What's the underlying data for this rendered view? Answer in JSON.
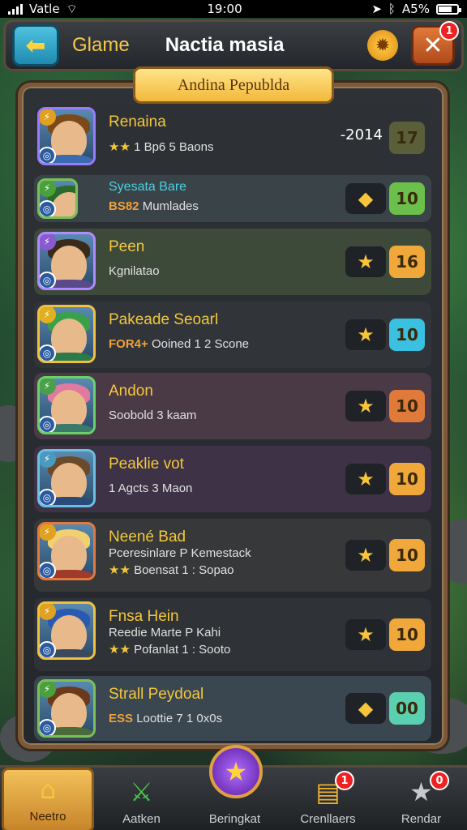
{
  "status_bar": {
    "carrier": "Vatle",
    "time": "19:00",
    "battery_text": "A5%"
  },
  "header": {
    "game_label": "Glame",
    "title": "Nactia masia",
    "close_badge": "1"
  },
  "panel": {
    "title": "Andina Pepublda"
  },
  "rows": [
    {
      "name": "Renaina",
      "sub": "1 Bp6 5 Baons",
      "stars": "★★",
      "extra": "-2014",
      "score": "17",
      "score_color": "#5a5f3a",
      "row_bg": "#2d3135",
      "avatar_border": "#9a7aff",
      "hair": "#7a4a1a",
      "body": "#3a6ab0",
      "tl_bg": "#e0a020",
      "star_icon": ""
    },
    {
      "name": "Syesata Bare",
      "sub": "Mumlades",
      "tag": "BS82",
      "score": "10",
      "score_color": "#6ac04a",
      "row_bg": "#3a4448",
      "avatar_border": "#7ac05a",
      "hair": "#2a6a2a",
      "body": "#7a3a1a",
      "tl_bg": "#4aa03a",
      "star_icon": "◆"
    },
    {
      "name": "Peen",
      "sub": "Kgnilatao",
      "score": "16",
      "score_color": "#f0a83a",
      "row_bg": "#3d4a3a",
      "avatar_border": "#b08aff",
      "hair": "#3a2a1a",
      "body": "#5a4a8a",
      "tl_bg": "#8a5ad0",
      "star_icon": "★"
    },
    {
      "name": "Pakeade Seoarl",
      "sub": "Ooined 1 2 Scone",
      "tag": "FOR4+",
      "score": "10",
      "score_color": "#3ac0e0",
      "row_bg": "#31353a",
      "avatar_border": "#f0c040",
      "hair": "#3aa04a",
      "body": "#2a7a4a",
      "tl_bg": "#e0b020",
      "star_icon": "★"
    },
    {
      "name": "Andon",
      "sub": "Soobold 3 kaam",
      "score": "10",
      "score_color": "#e07a3a",
      "row_bg": "#4a3a46",
      "avatar_border": "#6ad06a",
      "hair": "#e07aa0",
      "body": "#3a7a6a",
      "tl_bg": "#4aa04a",
      "star_icon": "★"
    },
    {
      "name": "Peaklie vot",
      "sub": "1 Agcts 3 Maon",
      "score": "10",
      "score_color": "#f0a83a",
      "row_bg": "#3d3246",
      "avatar_border": "#6ac0e0",
      "hair": "#6a4a2a",
      "body": "#2a4a7a",
      "tl_bg": "#4a9ac0",
      "star_icon": "★"
    },
    {
      "name": "Neené Bad",
      "sub": "Pceresinlare P Kemestack",
      "sub2": "Boensat 1 : Sopao",
      "stars": "★★",
      "score": "10",
      "score_color": "#f0a83a",
      "row_bg": "#36383a",
      "avatar_border": "#e07a40",
      "hair": "#f0d070",
      "body": "#a03a2a",
      "tl_bg": "#e0a020",
      "star_icon": "★"
    },
    {
      "name": "Fnsa Hein",
      "sub": "Reedie Marte P Kahi",
      "sub2": "Pofanlat 1 : Sooto",
      "stars": "★★",
      "score": "10",
      "score_color": "#f0a83a",
      "row_bg": "#2f3236",
      "avatar_border": "#f0c040",
      "hair": "#2a5ab0",
      "body": "#3a4a5a",
      "tl_bg": "#e0a020",
      "star_icon": "★"
    },
    {
      "name": "Strall Peydoal",
      "sub": "Loottie 7 1 0x0s",
      "tag": "ESS",
      "score": "00",
      "score_color": "#5ad0b0",
      "row_bg": "#3a4650",
      "avatar_border": "#7ac05a",
      "hair": "#6a3a1a",
      "body": "#4a6a3a",
      "tl_bg": "#4aa03a",
      "star_icon": "◆"
    }
  ],
  "nav": {
    "items": [
      {
        "label": "Neetro",
        "icon": "home-icon",
        "badge": ""
      },
      {
        "label": "Aatken",
        "icon": "sword-icon",
        "badge": ""
      },
      {
        "label": "Beringkat",
        "icon": "star-icon",
        "badge": ""
      },
      {
        "label": "Crenllaers",
        "icon": "chest-icon",
        "badge": "1"
      },
      {
        "label": "Rendar",
        "icon": "silver-star-icon",
        "badge": "0"
      }
    ]
  },
  "colors": {
    "accent": "#f4c73a",
    "panel_border": "#7a5a3a"
  }
}
